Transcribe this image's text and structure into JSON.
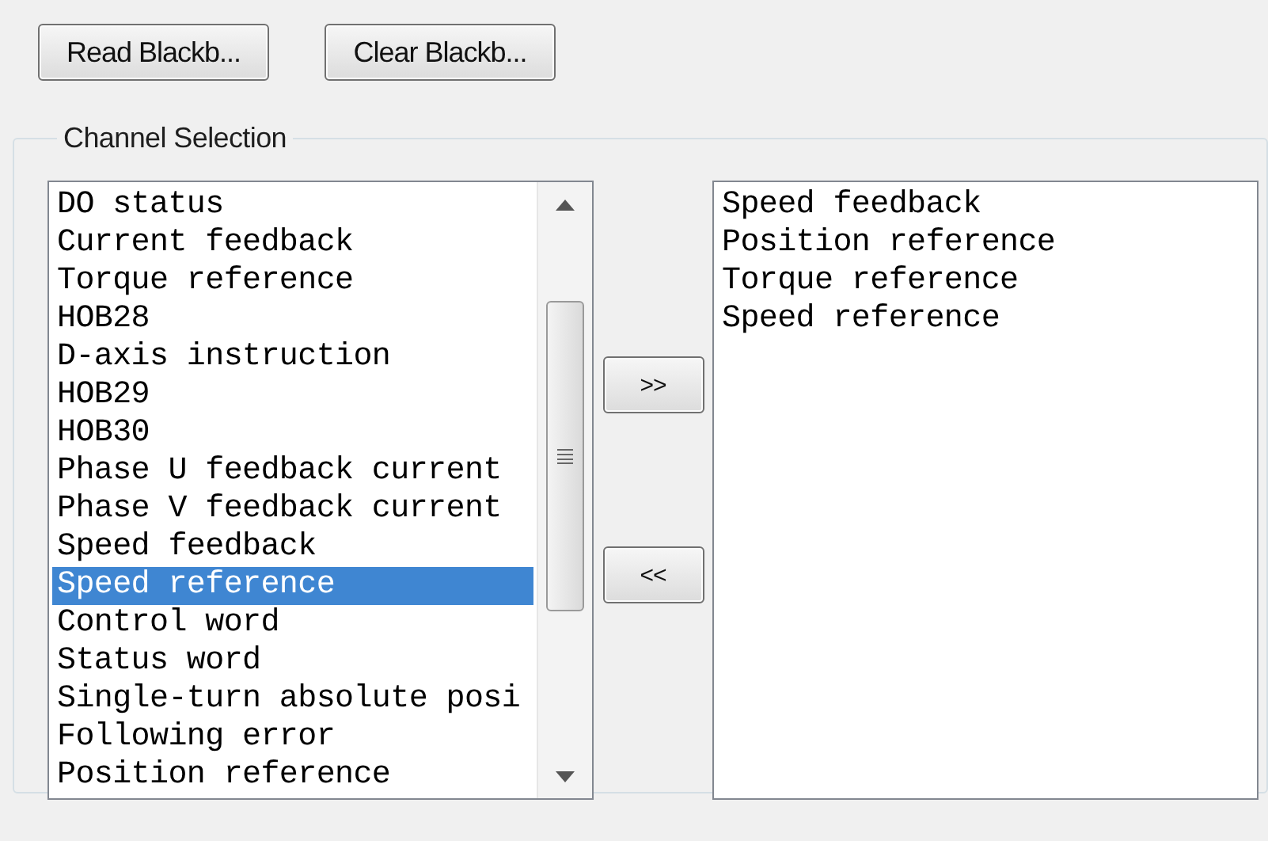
{
  "buttons": [
    "Read Blackb...",
    "Clear Blackb..."
  ],
  "channel_selection": {
    "title": "Channel Selection",
    "available": [
      {
        "label": "DO status",
        "selected": false
      },
      {
        "label": "Current feedback",
        "selected": false
      },
      {
        "label": "Torque reference",
        "selected": false
      },
      {
        "label": "HOB28",
        "selected": false
      },
      {
        "label": "D-axis instruction",
        "selected": false
      },
      {
        "label": "HOB29",
        "selected": false
      },
      {
        "label": "HOB30",
        "selected": false
      },
      {
        "label": "Phase U feedback current",
        "selected": false
      },
      {
        "label": "Phase V feedback current",
        "selected": false
      },
      {
        "label": "Speed feedback",
        "selected": false
      },
      {
        "label": "Speed reference",
        "selected": true
      },
      {
        "label": "Control word",
        "selected": false
      },
      {
        "label": "Status word",
        "selected": false
      },
      {
        "label": "Single-turn absolute posi",
        "selected": false
      },
      {
        "label": "Following error",
        "selected": false
      },
      {
        "label": "Position reference",
        "selected": false
      }
    ],
    "move_buttons": [
      ">>",
      "<<"
    ],
    "chosen": [
      "Speed feedback",
      "Position reference",
      "Torque reference",
      "Speed reference"
    ]
  }
}
